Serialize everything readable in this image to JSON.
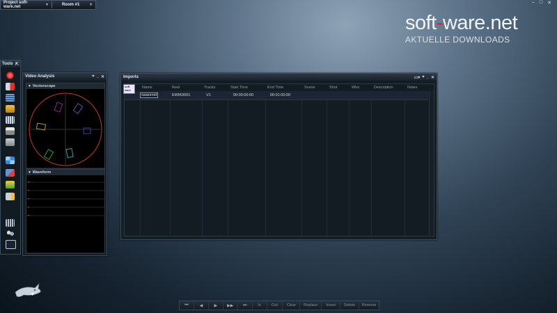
{
  "topbar": {
    "project": "Project soft-ware.net",
    "room": "Room #1"
  },
  "window_controls": [
    "–",
    "□",
    "✕"
  ],
  "logo": {
    "brand_part1": "soft",
    "brand_dash": "-",
    "brand_part2": "ware.net",
    "tagline": "AKTUELLE DOWNLOADS"
  },
  "tools": {
    "title": "Tools",
    "pin": "⇱",
    "icons": [
      "record-icon",
      "reel-icon",
      "list-icon",
      "folder-icon",
      "film-icon",
      "printer-icon",
      "keyboard-icon",
      "grid-icon",
      "transfer-icon",
      "star-icon",
      "export-icon",
      "matrix-icon",
      "users-icon",
      "monitor-icon"
    ]
  },
  "video_analysis": {
    "title": "Video Analysis",
    "vectorscope": "Vectorscope",
    "waveform": "Waveform"
  },
  "imports": {
    "title": "Imports",
    "columns": [
      "Name",
      "Reel",
      "Tracks",
      "Start Time",
      "End Time",
      "Scene",
      "Shot",
      "Who",
      "Description",
      "Notes"
    ],
    "row": {
      "thumb_line1": "soft",
      "thumb_line2": "ware",
      "name": "swarenet",
      "reel": "EWIK0001",
      "tracks": "V1",
      "start": "00:00:00:00",
      "end": "00:01:00:00"
    }
  },
  "transport": {
    "icons": [
      "⏮",
      "◀",
      "▶",
      "▶▶",
      "⏭"
    ],
    "labels": [
      "In",
      "Out",
      "Clear",
      "Replace",
      "Insert",
      "Delete",
      "Remove"
    ]
  },
  "colors": {
    "accent_red": "#d8232a",
    "panel_bg": "#141c24",
    "scope_circle": "#c0392b"
  }
}
